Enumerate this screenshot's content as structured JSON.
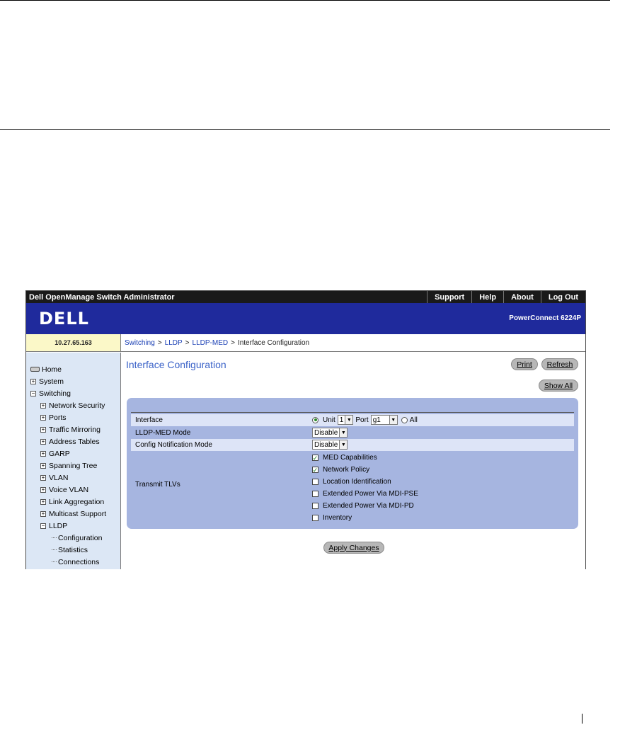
{
  "window": {
    "app_title": "Dell OpenManage Switch Administrator",
    "links": [
      "Support",
      "Help",
      "About",
      "Log Out"
    ]
  },
  "banner": {
    "logo_text": "DELL",
    "product": "PowerConnect 6224P"
  },
  "ip_address": "10.27.65.163",
  "breadcrumb": {
    "items": [
      "Switching",
      "LLDP",
      "LLDP-MED"
    ],
    "separator": ">",
    "current": "Interface Configuration"
  },
  "nav": {
    "home": "Home",
    "system": "System",
    "switching": "Switching",
    "switching_children": [
      "Network Security",
      "Ports",
      "Traffic Mirroring",
      "Address Tables",
      "GARP",
      "Spanning Tree",
      "VLAN",
      "Voice VLAN",
      "Link Aggregation",
      "Multicast Support",
      "LLDP"
    ],
    "lldp_children": [
      "Configuration",
      "Statistics",
      "Connections"
    ]
  },
  "page": {
    "title": "Interface Configuration",
    "print_label": "Print",
    "refresh_label": "Refresh",
    "show_all_label": "Show All",
    "apply_label": "Apply Changes"
  },
  "form": {
    "interface_label": "Interface",
    "unit_label": "Unit",
    "unit_value": "1",
    "port_label": "Port",
    "port_value": "g1",
    "all_label": "All",
    "selected_scope": "Unit",
    "lldp_med_mode_label": "LLDP-MED Mode",
    "lldp_med_mode_value": "Disable",
    "config_notification_label": "Config Notification Mode",
    "config_notification_value": "Disable",
    "transmit_tlvs_label": "Transmit TLVs",
    "tlvs": [
      {
        "label": "MED Capabilities",
        "checked": true
      },
      {
        "label": "Network Policy",
        "checked": true
      },
      {
        "label": "Location Identification",
        "checked": false
      },
      {
        "label": "Extended Power Via MDI-PSE",
        "checked": false
      },
      {
        "label": "Extended Power Via MDI-PD",
        "checked": false
      },
      {
        "label": "Inventory",
        "checked": false
      }
    ]
  },
  "colors": {
    "titlebar": "#1a1a1a",
    "banner": "#1f2a9c",
    "nav_bg": "#dce7f5",
    "panel_bg": "#a6b5e0",
    "heading": "#3a62c8",
    "link": "#1a3fb4"
  }
}
